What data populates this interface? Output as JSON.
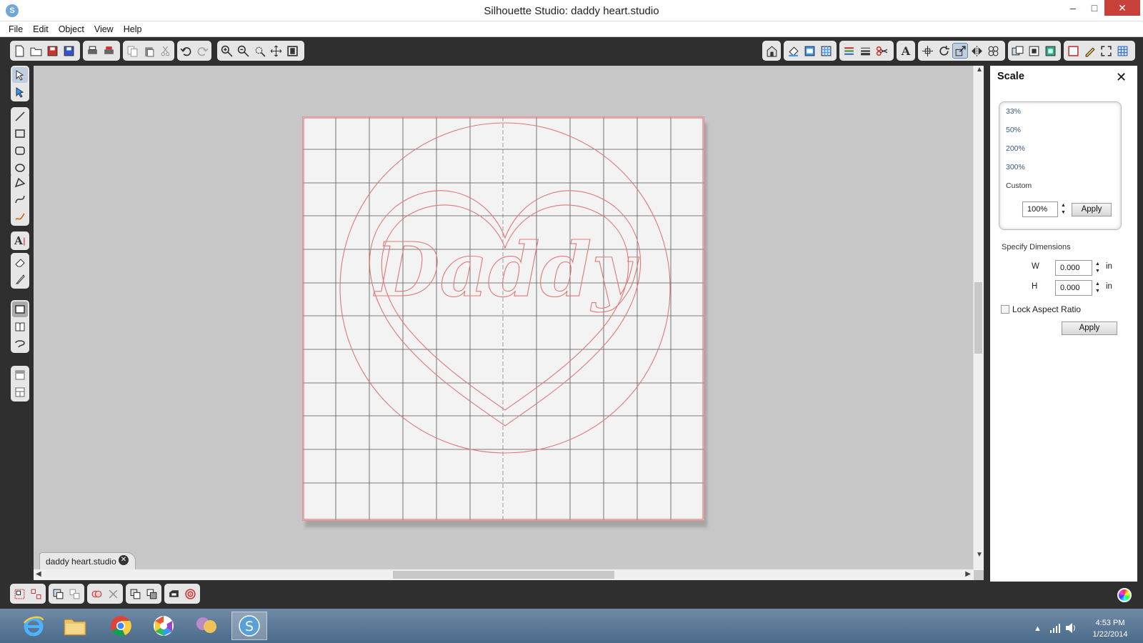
{
  "window": {
    "title": "Silhouette Studio: daddy heart.studio",
    "app_icon": "S",
    "minimize": "–",
    "maximize": "□",
    "close": "✕"
  },
  "menu": [
    "File",
    "Edit",
    "Object",
    "View",
    "Help"
  ],
  "document_tab": {
    "name": "daddy heart.studio",
    "close": "✕"
  },
  "design": {
    "text": "Daddy",
    "line_color": "#e07878"
  },
  "scale_panel": {
    "title": "Scale",
    "close": "✕",
    "presets": [
      "33%",
      "50%",
      "200%",
      "300%",
      "Custom"
    ],
    "custom_value": "100%",
    "apply_label": "Apply",
    "specify_dimensions": "Specify Dimensions",
    "w_label": "W",
    "w_value": "0.000",
    "h_label": "H",
    "h_value": "0.000",
    "unit": "in",
    "lock_aspect_label": "Lock Aspect Ratio",
    "lock_aspect_checked": false,
    "apply2_label": "Apply"
  },
  "taskbar": {
    "time": "4:53 PM",
    "date": "1/22/2014",
    "apps": [
      "internet-explorer",
      "file-explorer",
      "chrome",
      "picasa",
      "messenger",
      "silhouette-studio"
    ]
  },
  "colors": {
    "toolbar_bg": "#2f2f2f",
    "canvas_bg": "#c7c7c7",
    "accent_red": "#c7403a"
  }
}
